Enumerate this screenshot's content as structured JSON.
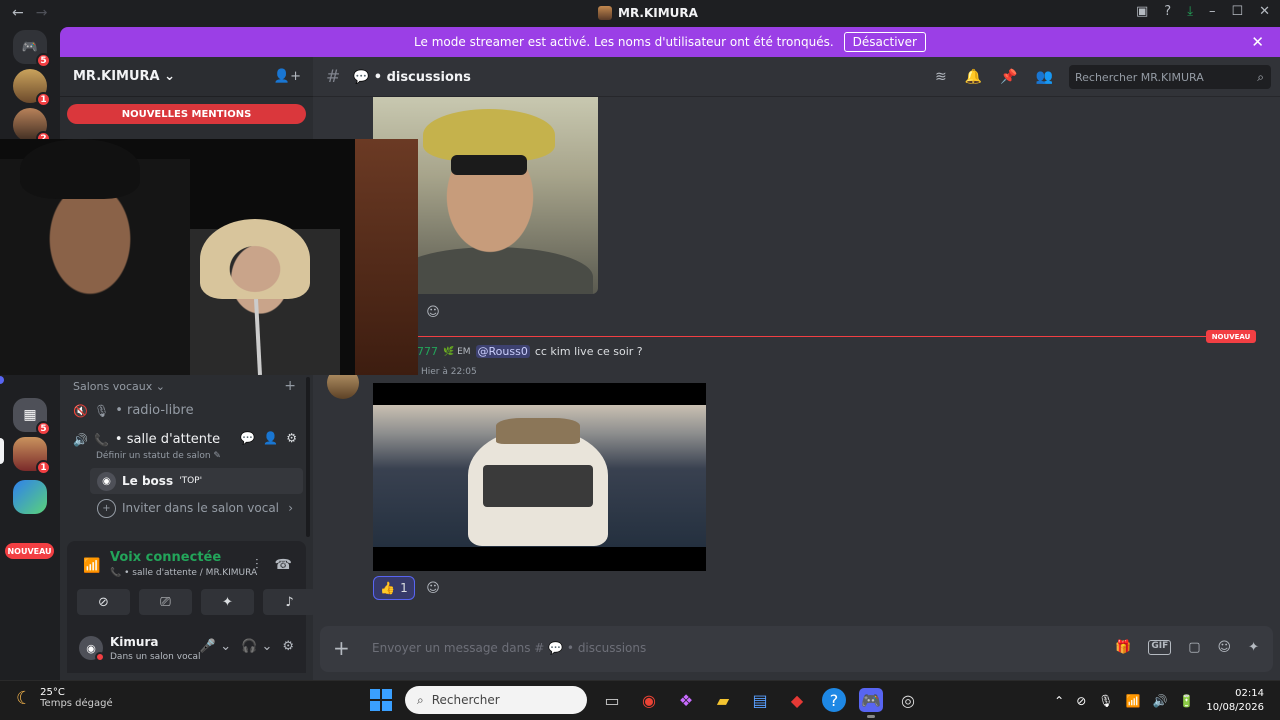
{
  "titlebar": {
    "title": "MR.KIMURA",
    "back": "←",
    "forward": "→"
  },
  "rail": {
    "servers": [
      {
        "name": "discord-home",
        "badge": "5"
      },
      {
        "name": "server-avatar-1",
        "badge": "1"
      },
      {
        "name": "server-avatar-2",
        "badge": "2"
      },
      {
        "name": "server-events",
        "badge": "5"
      },
      {
        "name": "server-avatar-3",
        "badge": "1"
      },
      {
        "name": "server-avatar-4",
        "badge": ""
      }
    ],
    "nouveau_label": "NOUVEAU"
  },
  "banner": {
    "text": "Le mode streamer est activé. Les noms d'utilisateur ont été tronqués.",
    "button": "Désactiver",
    "close": "✕"
  },
  "sidebar": {
    "guild_name": "MR.KIMURA",
    "mentions_label": "NOUVELLES MENTIONS",
    "voice_category": "Salons vocaux",
    "channels": [
      {
        "name": "radio-libre"
      },
      {
        "name": "salle d'attente"
      }
    ],
    "channel_status": "Définir un statut de salon",
    "member_name": "Le boss",
    "member_tag": "'TOP'",
    "invite_label": "Inviter dans le salon vocal"
  },
  "voice_panel": {
    "title": "Voix connectée",
    "subtitle": "salle d'attente / MR.KIMURA"
  },
  "user_panel": {
    "username": "Kimura",
    "status": "Dans un salon vocal"
  },
  "chat": {
    "channel_name": "discussions",
    "search_placeholder": "Rechercher MR.KIMURA",
    "new_tag": "NOUVEAU",
    "reply": {
      "author": "777",
      "author_tag": "EM",
      "mention": "@Rouss0",
      "text": "cc kim live ce soir ?"
    },
    "timestamp": "Hier à 22:05",
    "reaction_emoji": "👍",
    "reaction_count": "1",
    "composer_placeholder": "Envoyer un message dans #",
    "composer_channel": "discussions",
    "gif_label": "GIF"
  },
  "taskbar": {
    "temperature": "25°C",
    "weather": "Temps dégagé",
    "search_placeholder": "Rechercher",
    "time": "02:14",
    "date": "10/08/2026"
  }
}
